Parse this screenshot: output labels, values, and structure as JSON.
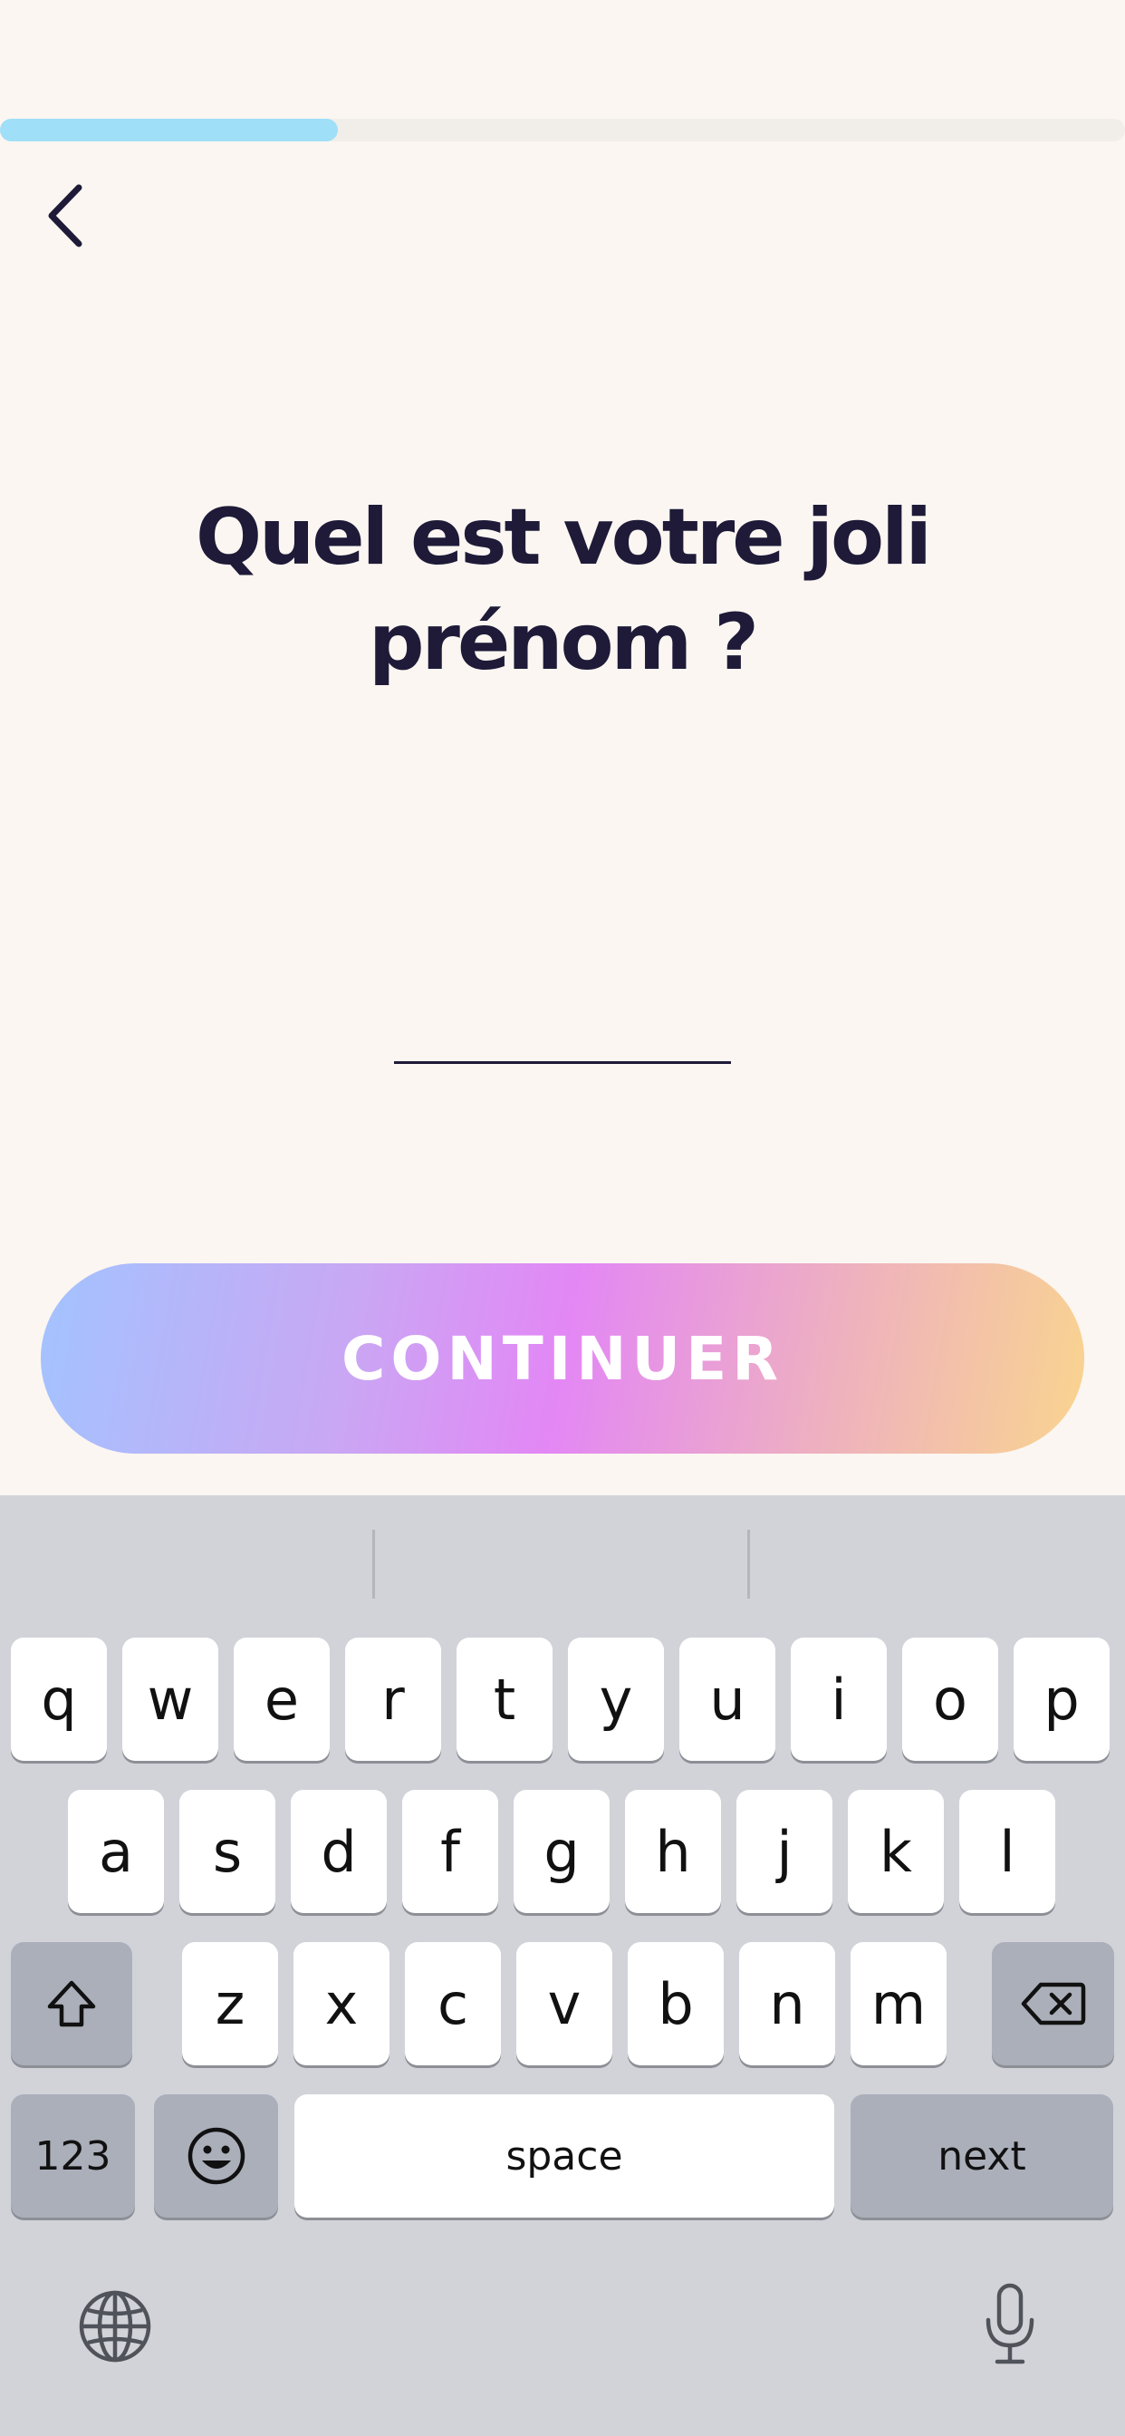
{
  "progress": {
    "fraction": 0.3
  },
  "title": "Quel est votre joli prénom ?",
  "name_input": {
    "value": "",
    "placeholder": ""
  },
  "continue_label": "CONTINUER",
  "keyboard": {
    "row1": [
      "q",
      "w",
      "e",
      "r",
      "t",
      "y",
      "u",
      "i",
      "o",
      "p"
    ],
    "row2": [
      "a",
      "s",
      "d",
      "f",
      "g",
      "h",
      "j",
      "k",
      "l"
    ],
    "row3": [
      "z",
      "x",
      "c",
      "v",
      "b",
      "n",
      "m"
    ],
    "numbers_label": "123",
    "space_label": "space",
    "next_label": "next"
  },
  "icons": {
    "back": "chevron-left-icon",
    "shift": "shift-icon",
    "delete": "delete-icon",
    "emoji": "emoji-icon",
    "globe": "globe-icon",
    "mic": "microphone-icon"
  },
  "colors": {
    "background": "#fbf6f1",
    "progress": "#9fdff8",
    "title": "#1e1a38",
    "keyboard": "#d1d3d9"
  }
}
